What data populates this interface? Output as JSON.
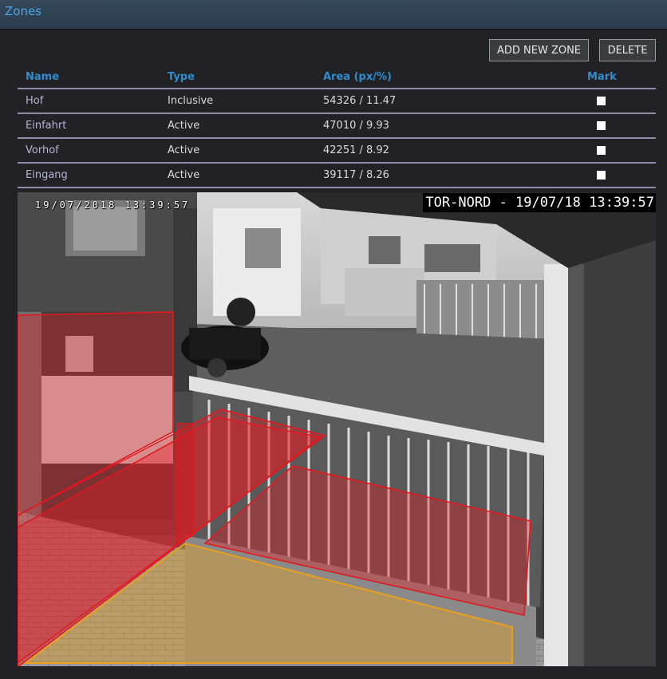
{
  "window": {
    "title": "Zones"
  },
  "toolbar": {
    "add_label": "ADD NEW ZONE",
    "delete_label": "DELETE"
  },
  "table": {
    "columns": {
      "name": "Name",
      "type": "Type",
      "area": "Area (px/%)",
      "mark": "Mark"
    },
    "rows": [
      {
        "name": "Hof",
        "type": "Inclusive",
        "area": "54326 / 11.47",
        "marked": false
      },
      {
        "name": "Einfahrt",
        "type": "Active",
        "area": "47010 / 9.93",
        "marked": false
      },
      {
        "name": "Vorhof",
        "type": "Active",
        "area": "42251 / 8.92",
        "marked": false
      },
      {
        "name": "Eingang",
        "type": "Active",
        "area": "39117 / 8.26",
        "marked": false
      }
    ]
  },
  "camera": {
    "osd_date": "19/07/2018 13:39:57",
    "osd_label": "TOR-NORD - 19/07/18 13:39:57"
  },
  "colors": {
    "accent": "#2f8dd0",
    "zone_active": "#e0191e",
    "zone_inclusive": "#e8a020",
    "row_divider": "#8e8ca8"
  }
}
